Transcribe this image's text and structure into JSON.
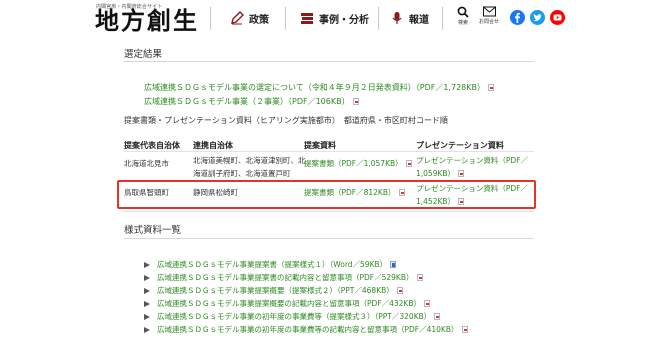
{
  "header": {
    "site_tag": "内閣官房・内閣府総合サイト",
    "site_title": "地方創生",
    "nav": [
      {
        "label": "政策",
        "icon": "pencil-icon"
      },
      {
        "label": "事例・分析",
        "icon": "books-icon"
      },
      {
        "label": "報道",
        "icon": "microphone-icon"
      }
    ],
    "tools": [
      {
        "label": "検索",
        "icon": "search-icon"
      },
      {
        "label": "お問合せ",
        "icon": "mail-icon"
      }
    ],
    "social": [
      {
        "name": "facebook-icon",
        "color": "#1877f2"
      },
      {
        "name": "twitter-icon",
        "color": "#1d9bf0"
      },
      {
        "name": "youtube-icon",
        "color": "#ff0000"
      }
    ]
  },
  "selection": {
    "heading": "選定結果",
    "links": [
      {
        "text": "広域連携ＳＤＧｓモデル事業の選定について（令和４年９月２日発表資料）（PDF／1,728KB）",
        "file": "PDF"
      },
      {
        "text": "広域連携ＳＤＧｓモデル事業（２事業）（PDF／106KB）",
        "file": "PDF"
      }
    ],
    "subheading": "提案書類・プレゼンテーション資料（ヒアリング実施都市）　都道府県・市区町村コード順",
    "table": {
      "headers": [
        "提案代表自治体",
        "連携自治体",
        "提案資料",
        "プレゼンテーション資料"
      ],
      "rows": [
        {
          "lead": "北海道北見市",
          "partners": [
            "北海道美幌町、北海道津別町、北",
            "海道訓子府町、北海道置戸町"
          ],
          "proposal": "提案書類（PDF／1,057KB）",
          "presentation": [
            "プレゼンテーション資料（PDF／",
            "1,059KB）"
          ]
        },
        {
          "lead": "鳥取県智頭町",
          "partners": [
            "静岡県松崎町"
          ],
          "proposal": "提案書類（PDF／812KB）",
          "presentation": [
            "プレゼンテーション資料（PDF／",
            "1,452KB）"
          ]
        }
      ]
    },
    "highlight_color": "#e3332b"
  },
  "forms": {
    "heading": "様式資料一覧",
    "items": [
      {
        "text": "広域連携ＳＤＧｓモデル事業提案書（提案様式１）（Word／59KB）",
        "file": "Word"
      },
      {
        "text": "広域連携ＳＤＧｓモデル事業提案書の記載内容と留意事項（PDF／529KB）",
        "file": "PDF"
      },
      {
        "text": "広域連携ＳＤＧｓモデル事業提案概要（提案様式２）（PPT／468KB）",
        "file": "PDF"
      },
      {
        "text": "広域連携ＳＤＧｓモデル事業提案概要の記載内容と留意事項（PDF／432KB）",
        "file": "PDF"
      },
      {
        "text": "広域連携ＳＤＧｓモデル事業の初年度の事業費等（提案様式３）（PPT／320KB）",
        "file": "PDF"
      },
      {
        "text": "広域連携ＳＤＧｓモデル事業の初年度の事業費等の記載内容と留意事項（PDF／410KB）",
        "file": "PDF"
      }
    ]
  },
  "colors": {
    "link": "#2e8b22",
    "header_bg": "#ffffff"
  }
}
